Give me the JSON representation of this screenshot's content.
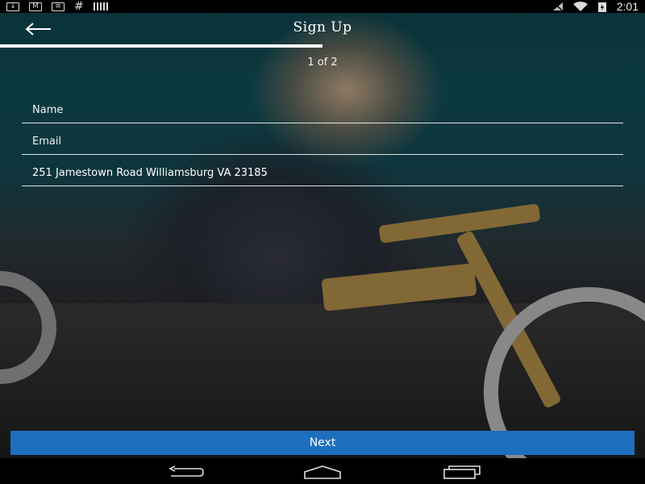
{
  "status_bar": {
    "time": "2:01",
    "left_icons": [
      "download-icon",
      "gmail-icon",
      "message-icon",
      "hash-icon",
      "barcode-icon"
    ],
    "right_icons": [
      "no-signal-icon",
      "wifi-icon",
      "battery-icon"
    ]
  },
  "header": {
    "title": "Sign Up",
    "back_icon": "arrow-left-icon",
    "progress": 0.5,
    "step_text": "1 of 2"
  },
  "form": {
    "name_placeholder": "Name",
    "name_value": "",
    "email_placeholder": "Email",
    "email_value": "",
    "address_placeholder": "",
    "address_value": "251 Jamestown Road Williamsburg VA 23185"
  },
  "next_button": {
    "label": "Next",
    "color": "#1d6fbe"
  },
  "nav_bar": {
    "icons": [
      "back-nav-icon",
      "home-nav-icon",
      "recents-nav-icon"
    ]
  }
}
